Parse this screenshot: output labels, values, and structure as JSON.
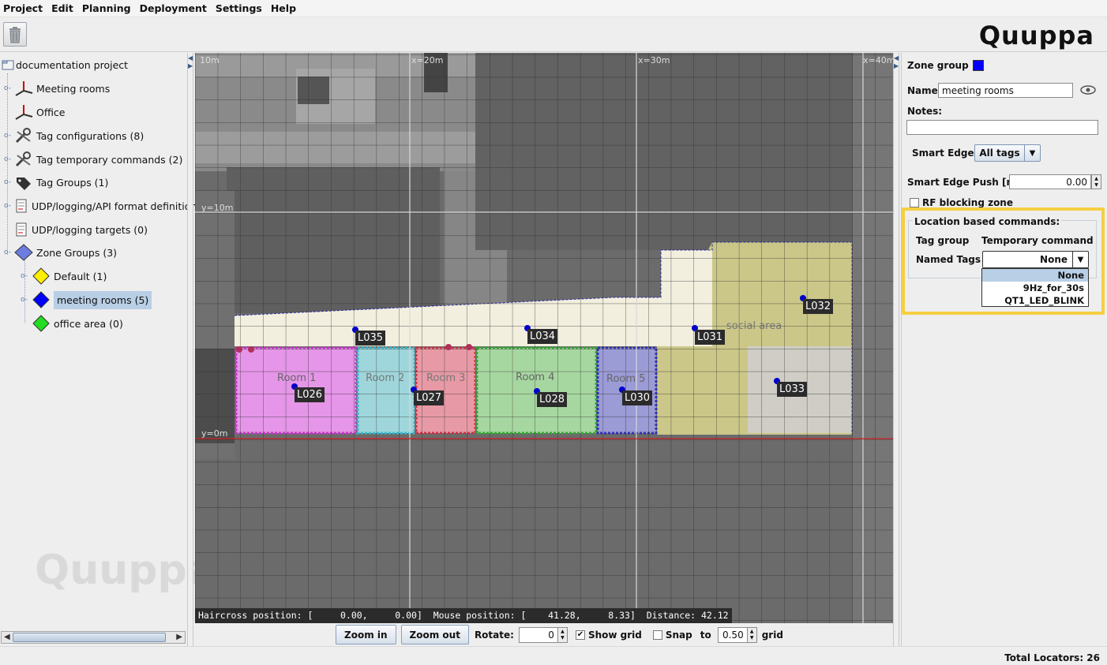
{
  "menu": [
    "Project",
    "Edit",
    "Planning",
    "Deployment",
    "Settings",
    "Help"
  ],
  "logo": "Quuppa",
  "watermark": "Quuppa",
  "tree": {
    "root": "documentation project",
    "items": [
      {
        "label": "Meeting rooms",
        "icon": "axes-icon"
      },
      {
        "label": "Office",
        "icon": "axes-icon"
      },
      {
        "label": "Tag configurations (8)",
        "icon": "wrench-icon"
      },
      {
        "label": "Tag temporary commands (2)",
        "icon": "wrench-icon"
      },
      {
        "label": "Tag Groups (1)",
        "icon": "tag-icon"
      },
      {
        "label": "UDP/logging/API format definitions (",
        "icon": "document-icon"
      },
      {
        "label": "UDP/logging targets (0)",
        "icon": "document-icon"
      },
      {
        "label": "Zone Groups (3)",
        "icon": "zone-group-icon"
      }
    ],
    "zone_groups": [
      {
        "label": "Default (1)",
        "color": "#ffee00"
      },
      {
        "label": "meeting rooms (5)",
        "color": "#0000ff"
      },
      {
        "label": "office area (0)",
        "color": "#22dd22"
      }
    ]
  },
  "map": {
    "axis_labels": [
      "10m",
      "x=20m",
      "x=30m",
      "x=40m",
      "y=10m",
      "y=0m"
    ],
    "rooms": [
      "Room 1",
      "Room 2",
      "Room 3",
      "Room 4",
      "Room 5"
    ],
    "area_label": "social area",
    "locators": [
      "L035",
      "L034",
      "L031",
      "L032",
      "L026",
      "L027",
      "L028",
      "L030",
      "L033"
    ],
    "readout": "Haircross position: [     0.00,     0.00]  Mouse position: [    41.28,     8.33]  Distance: 42.12"
  },
  "controls": {
    "zoom_in": "Zoom in",
    "zoom_out": "Zoom out",
    "rotate_label": "Rotate:",
    "rotate_value": "0",
    "show_grid": "Show grid",
    "snap": "Snap",
    "to": "to",
    "snap_value": "0.50",
    "grid": "grid"
  },
  "props": {
    "zone_group_label": "Zone group",
    "zone_group_color": "#0000ff",
    "name_label": "Name:",
    "name_value": "meeting rooms",
    "notes_label": "Notes:",
    "notes_value": "",
    "smart_edge_label": "Smart Edge :",
    "smart_edge_value": "All tags",
    "smart_edge_push_label": "Smart Edge Push  [m]:",
    "smart_edge_push_value": "0.00",
    "rf_blocking": "RF blocking zone",
    "lbc_title": "Location based commands:",
    "col_tag_group": "Tag group",
    "col_temp_cmd": "Temporary command",
    "row_named_tags": "Named Tags",
    "cmd_value": "None",
    "cmd_options": [
      "None",
      "9Hz_for_30s",
      "QT1_LED_BLINK"
    ]
  },
  "status": "Total Locators: 26"
}
